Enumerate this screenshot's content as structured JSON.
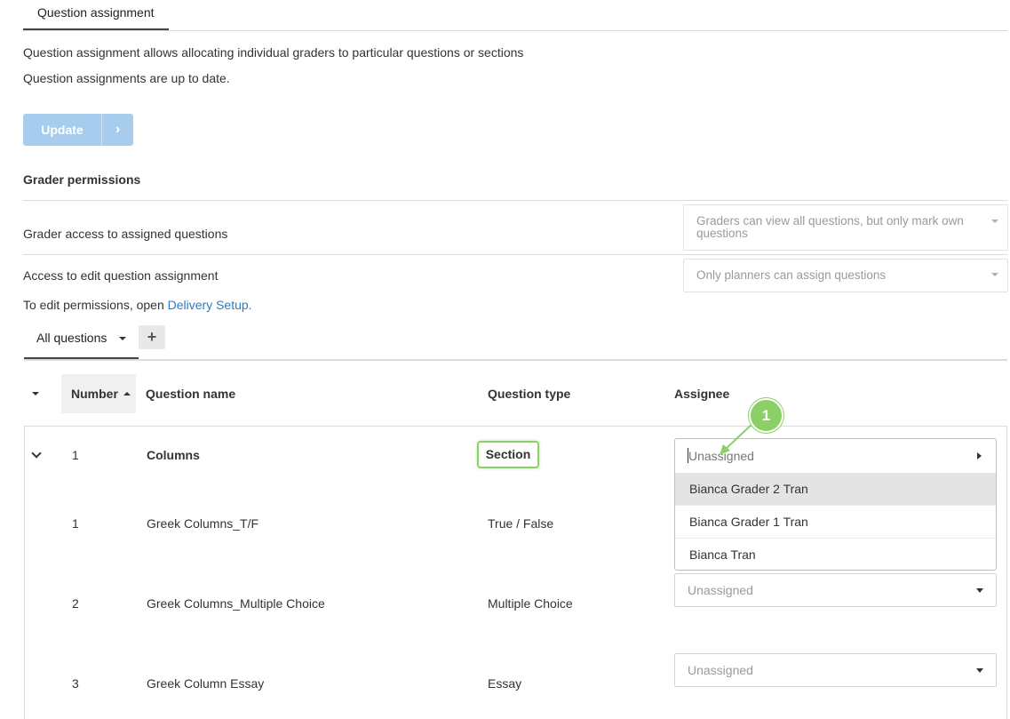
{
  "top_tab": {
    "label": "Question assignment"
  },
  "intro": {
    "description": "Question assignment allows allocating individual graders to particular questions or sections",
    "status": "Question assignments are up to date."
  },
  "update_button": {
    "label": "Update"
  },
  "permissions": {
    "heading": "Grader permissions",
    "access_label": "Grader access to assigned questions",
    "access_value": "Graders can view all questions, but only mark own questions",
    "edit_label": "Access to edit question assignment",
    "edit_value": "Only planners can assign questions",
    "note_prefix": "To edit permissions, open ",
    "note_link": "Delivery Setup."
  },
  "question_tabs": {
    "active": "All questions",
    "add_symbol": "+"
  },
  "table": {
    "headers": {
      "number": "Number",
      "name": "Question name",
      "type": "Question type",
      "assignee": "Assignee"
    },
    "rows": [
      {
        "number": "1",
        "name": "Columns",
        "type": "Section",
        "assignee": "Unassigned"
      },
      {
        "number": "1",
        "name": "Greek Columns_T/F",
        "type": "True / False",
        "assignee": ""
      },
      {
        "number": "2",
        "name": "Greek Columns_Multiple Choice",
        "type": "Multiple Choice",
        "assignee": "Unassigned"
      },
      {
        "number": "3",
        "name": "Greek Column Essay",
        "type": "Essay",
        "assignee": "Unassigned"
      }
    ]
  },
  "assignee_dropdown": {
    "current": "Unassigned",
    "options": [
      "Bianca Grader 2 Tran",
      "Bianca Grader 1 Tran",
      "Bianca Tran"
    ],
    "highlighted_index": 0
  },
  "callout": {
    "number": "1"
  },
  "colors": {
    "accent_green": "#8bd066",
    "link_blue": "#2d7bc2",
    "button_disabled": "#a6cdee"
  }
}
